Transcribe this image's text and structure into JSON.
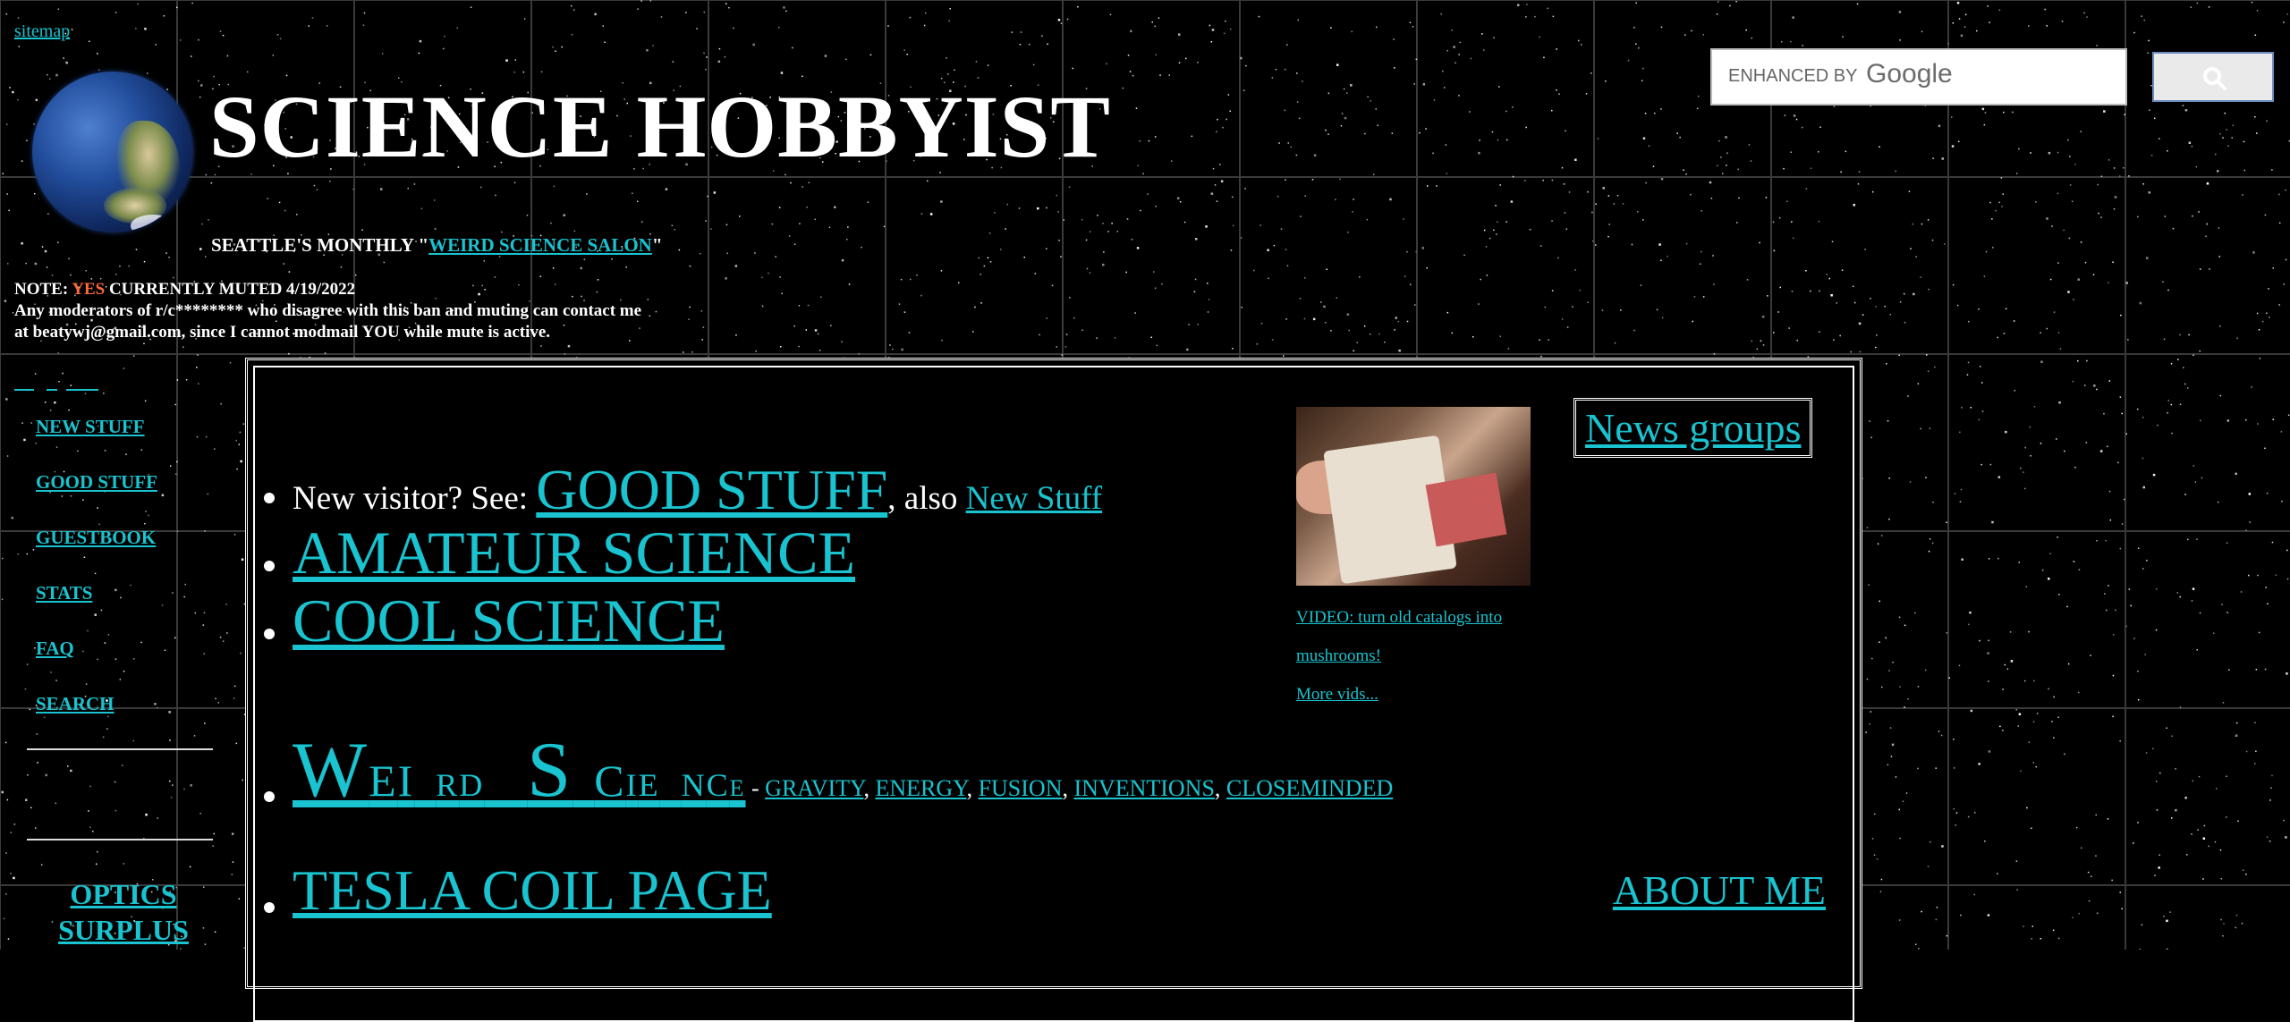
{
  "header": {
    "sitemap_link": "sitemap",
    "site_title": "SCIENCE HOBBYIST",
    "salon_prefix": "SEATTLE'S MONTHLY \"",
    "salon_link": "WEIRD SCIENCE SALON",
    "salon_suffix": "\"",
    "globe_icon": "earth-globe-icon"
  },
  "note": {
    "prefix": "NOTE: ",
    "highlight": "YES",
    "rest_line1": " CURRENTLY MUTED 4/19/2022",
    "line2": "Any moderators of r/c******** who disagree with this ban and muting can contact me at beatywj@gmail.com, since I cannot modmail YOU while mute is active.",
    "highlight_color": "#ff6a3a"
  },
  "search": {
    "label": "ENHANCED BY",
    "brand": "Google",
    "button_icon": "search-icon"
  },
  "sidebar": {
    "items": [
      {
        "label": "NEW STUFF"
      },
      {
        "label": "GOOD STUFF"
      },
      {
        "label": "GUESTBOOK"
      },
      {
        "label": "STATS"
      },
      {
        "label": "FAQ"
      },
      {
        "label": "SEARCH"
      }
    ],
    "optics_line1": "OPTICS",
    "optics_line2": "SURPLUS"
  },
  "main": {
    "visitor_text": "New visitor? See: ",
    "good_stuff_link": "GOOD STUFF",
    "also_text": ", also ",
    "new_stuff_link": "New Stuff",
    "amateur_link": "AMATEUR SCIENCE",
    "cool_link": "COOL SCIENCE",
    "weird_W": "W",
    "weird_E": "E",
    "weird_I": "I",
    "weird_R": "R",
    "weird_D": "D",
    "weird_S": "S",
    "weird_C": "C",
    "weird_I2": "I",
    "weird_E2": "E",
    "weird_N": "N",
    "weird_C2": "C",
    "weird_E3": "E",
    "dash": " - ",
    "sub_links": [
      "GRAVITY",
      "ENERGY",
      "FUSION",
      "INVENTIONS",
      "CLOSEMINDED"
    ],
    "tesla_link": "TESLA COIL PAGE",
    "about_link": "ABOUT ME",
    "newsgroups_link": "News groups",
    "video_line1": "VIDEO: turn old catalogs into",
    "video_line2": "mushrooms!",
    "more_vids": "More vids..."
  },
  "colors": {
    "link": "#19c3cf",
    "background": "#000000"
  }
}
